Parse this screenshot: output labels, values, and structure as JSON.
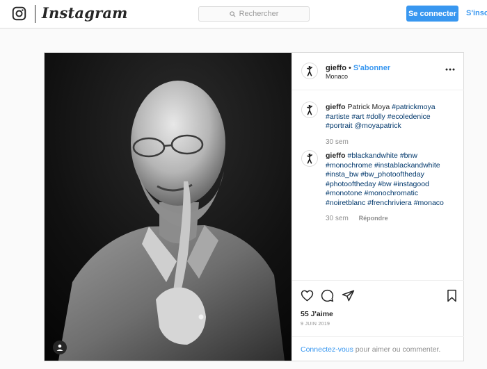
{
  "header": {
    "brand": "Instagram",
    "search_placeholder": "Rechercher",
    "login_label": "Se connecter",
    "signup_label": "S'inscr"
  },
  "post": {
    "author": "gieffo",
    "separator": "•",
    "follow_label": "S'abonner",
    "location": "Monaco",
    "comments": [
      {
        "username": "gieffo",
        "text": "Patrick Moya",
        "tags": [
          "#patrickmoya",
          "#artiste",
          "#art",
          "#dolly",
          "#ecoledenice",
          "#portrait",
          "@moyapatrick"
        ],
        "time": "30 sem"
      },
      {
        "username": "gieffo",
        "text": "",
        "tags": [
          "#blackandwhite",
          "#bnw",
          "#monochrome",
          "#instablackandwhite",
          "#insta_bw",
          "#bw_photooftheday",
          "#photooftheday",
          "#bw",
          "#instagood",
          "#monotone",
          "#monochromatic",
          "#noiretblanc",
          "#frenchriviera",
          "#monaco"
        ],
        "time": "30 sem",
        "reply_label": "Répondre"
      }
    ],
    "likes": "55 J'aime",
    "date": "9 JUIN 2019",
    "login_prompt_link": "Connectez-vous",
    "login_prompt_rest": " pour aimer ou commenter."
  },
  "icons": {
    "logo": "instagram-glyph-icon",
    "search": "search-icon",
    "more": "more-options-icon",
    "like": "heart-icon",
    "comment": "comment-icon",
    "share": "paper-plane-icon",
    "save": "bookmark-icon",
    "tags": "user-tag-icon"
  },
  "colors": {
    "accent": "#3897f0",
    "hashtag": "#00376b",
    "muted": "#8e8e8e"
  }
}
